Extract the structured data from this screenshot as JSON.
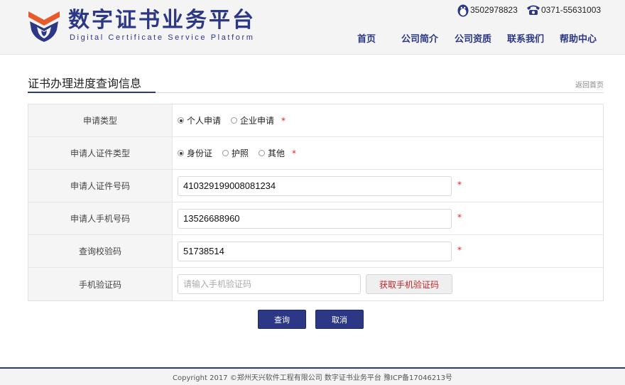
{
  "header": {
    "title": "数字证书业务平台",
    "subtitle": "Digital Certificate Service Platform",
    "phone_qq": "3502978823",
    "phone_tel": "0371-55631003"
  },
  "nav": {
    "items": [
      "首页",
      "公司简介",
      "公司资质",
      "联系我们",
      "帮助中心"
    ]
  },
  "section": {
    "title": "证书办理进度查询信息",
    "back_link": "返回首页"
  },
  "form": {
    "apply_type": {
      "label": "申请类型",
      "options": [
        "个人申请",
        "企业申请"
      ],
      "selected": "个人申请",
      "required_mark": "*"
    },
    "id_type": {
      "label": "申请人证件类型",
      "options": [
        "身份证",
        "护照",
        "其他"
      ],
      "selected": "身份证",
      "required_mark": "*"
    },
    "id_number": {
      "label": "申请人证件号码",
      "value": "410329199008081234",
      "required_mark": "*"
    },
    "mobile": {
      "label": "申请人手机号码",
      "value": "13526688960",
      "required_mark": "*"
    },
    "check_code": {
      "label": "查询校验码",
      "value": "51738514",
      "required_mark": "*"
    },
    "sms_code": {
      "label": "手机验证码",
      "placeholder": "请输入手机验证码",
      "button": "获取手机验证码"
    }
  },
  "actions": {
    "query": "查询",
    "cancel": "取消"
  },
  "footer": {
    "text": "Copyright 2017 ©郑州天兴软件工程有限公司 数字证书业务平台 豫ICP备17046213号"
  },
  "colors": {
    "brand": "#2c3786",
    "accent_red": "#c0262c",
    "logo_orange": "#e85a2a"
  }
}
